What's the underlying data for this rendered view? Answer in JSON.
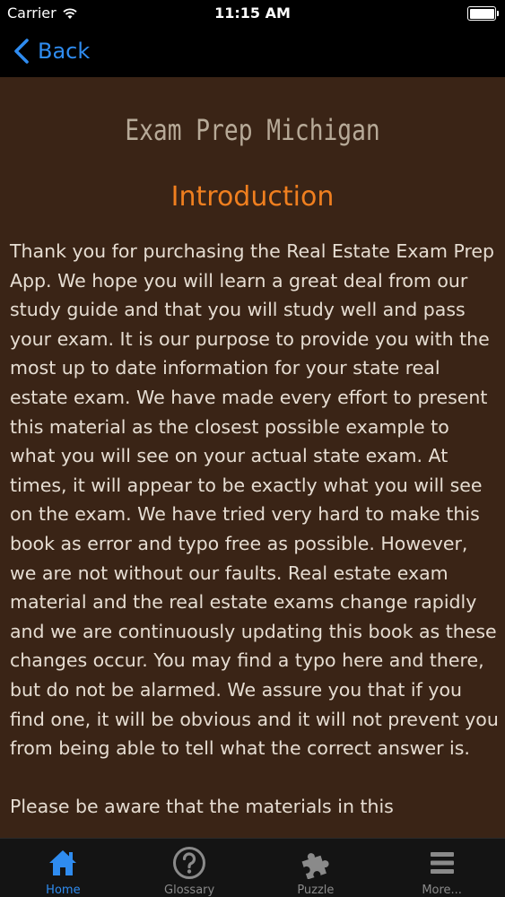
{
  "status_bar": {
    "carrier": "Carrier",
    "time": "11:15 AM"
  },
  "nav": {
    "back_label": "Back"
  },
  "content": {
    "app_title": "Exam Prep Michigan",
    "section_title": "Introduction",
    "paragraphs": [
      "Thank you for purchasing the Real Estate Exam Prep App. We hope you will learn a great deal from our study guide and that you will study well and pass your exam. It is our purpose to provide you with the most up to date information for your state real estate exam. We have made every effort to present this material as the closest possible example to what you will see on your actual state exam. At times, it will appear to be exactly what you will see on the exam. We have tried very hard to make this book as error and typo free as possible. However, we are not without our faults. Real estate exam material and the real estate exams change rapidly and we are continuously updating this book as these changes occur. You may find a typo here and there, but do not be alarmed. We assure you that if you find one, it will be obvious and it will not prevent you from being able to tell what the correct answer is.",
      "Please be aware that the materials in this"
    ]
  },
  "tabs": [
    {
      "label": "Home",
      "icon": "home-icon",
      "active": true
    },
    {
      "label": "Glossary",
      "icon": "question-icon",
      "active": false
    },
    {
      "label": "Puzzle",
      "icon": "puzzle-icon",
      "active": false
    },
    {
      "label": "More...",
      "icon": "menu-icon",
      "active": false
    }
  ],
  "colors": {
    "accent": "#2f8cf0",
    "content_bg": "#3a2416",
    "section_title": "#f07f1f",
    "body_text": "#e6ddd2"
  }
}
